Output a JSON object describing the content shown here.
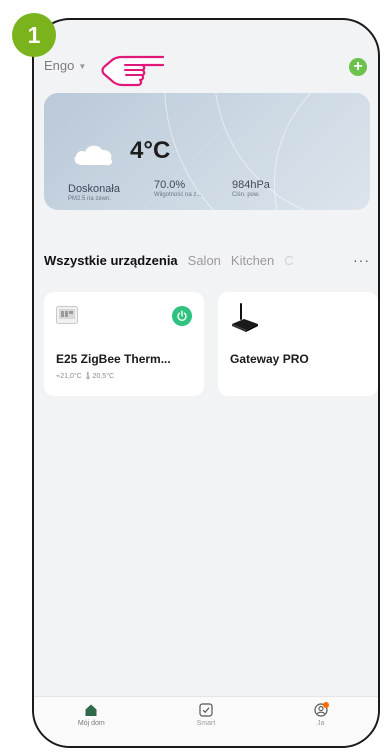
{
  "step": {
    "number": "1",
    "color": "#7bb31c"
  },
  "header": {
    "home_name": "Engo",
    "dropdown_icon": "chevron-down-icon",
    "add_icon": "plus-circle-icon"
  },
  "weather": {
    "icon": "cloud-icon",
    "temperature": "4°C",
    "stats": [
      {
        "value": "Doskonała",
        "label": "PM2.5 na zewn."
      },
      {
        "value": "70.0%",
        "label": "Wilgotność na z..."
      },
      {
        "value": "984hPa",
        "label": "Ciśn. pow."
      }
    ]
  },
  "tabs": {
    "items": [
      "Wszystkie urządzenia",
      "Salon",
      "Kitchen",
      "C"
    ],
    "active_index": 0,
    "more_label": "···"
  },
  "devices": [
    {
      "name": "E25 ZigBee Therm...",
      "meta": "⌁21,0°C  🌡20,5°C",
      "icon": "thermostat-icon",
      "power": "on"
    },
    {
      "name": "Gateway PRO",
      "meta": "",
      "icon": "gateway-router-icon"
    }
  ],
  "bottom_nav": [
    {
      "label": "Mój dom",
      "icon": "home-icon",
      "active": true
    },
    {
      "label": "Smart",
      "icon": "checkbox-icon",
      "active": false
    },
    {
      "label": "Ja",
      "icon": "profile-icon",
      "active": false
    }
  ],
  "colors": {
    "accent_green": "#6cc24a",
    "power_on": "#2ec27e",
    "pointer_pink": "#e0187a",
    "notify_orange": "#ff6a00"
  }
}
